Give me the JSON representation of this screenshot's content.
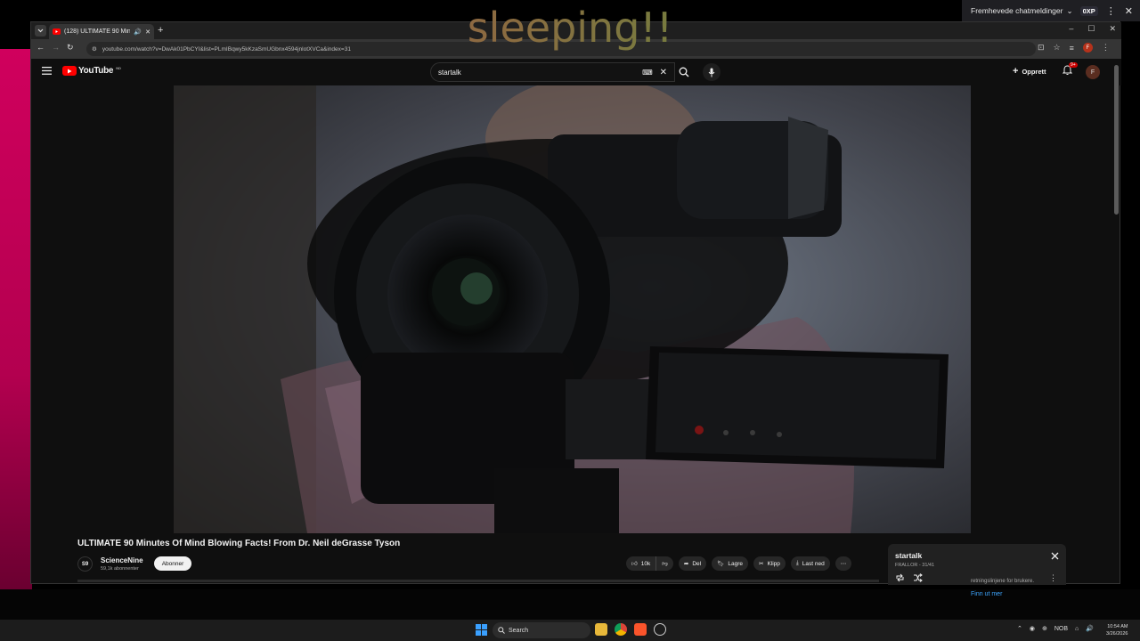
{
  "overlay": {
    "text": "sleeping!!"
  },
  "chat": {
    "header_label": "Fremhevede chatmeldinger",
    "xp_badge": "0XP",
    "footer_text": "retningslinjene for brukere.",
    "footer_link": "Finn ut mer"
  },
  "browser": {
    "tab_title": "(128) ULTIMATE 90 Minute",
    "url": "youtube.com/watch?v=DwAk01PbCYI&list=PLmIBqwy5kKzaSmUGbnx4594jnlotXVCa&index=31",
    "profile_initial": "F"
  },
  "youtube": {
    "logo_text": "YouTube",
    "logo_suffix": "NO",
    "search_value": "startalk",
    "create_label": "Opprett",
    "notification_count": "9+",
    "avatar_initial": "F"
  },
  "video": {
    "title": "ULTIMATE 90 Minutes Of Mind Blowing Facts! From Dr. Neil deGrasse Tyson",
    "channel_avatar_text": "S9",
    "channel_name": "ScienceNine",
    "channel_subs": "59,1k abonnenter",
    "subscribe_label": "Abonner",
    "actions": {
      "like_count": "10k",
      "share": "Del",
      "save": "Lagre",
      "clip": "Klipp",
      "download": "Last ned"
    }
  },
  "playlist": {
    "title": "startalk",
    "subtitle": "FRALLOR - 31/41"
  },
  "taskbar": {
    "search_label": "Search",
    "lang": "NOB",
    "time": "10:54 AM",
    "date": "3/26/2026"
  }
}
